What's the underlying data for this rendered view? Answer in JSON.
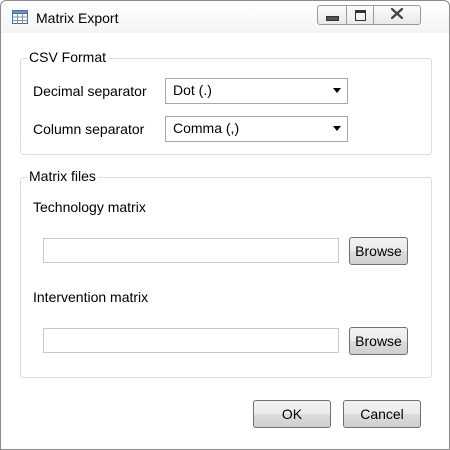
{
  "window": {
    "title": "Matrix Export",
    "icon": "table-window-icon",
    "controls": [
      "minimize-icon",
      "maximize-icon",
      "close-icon"
    ]
  },
  "csv_format": {
    "legend": "CSV Format",
    "decimal_separator": {
      "label": "Decimal separator",
      "value": "Dot (.)"
    },
    "column_separator": {
      "label": "Column separator",
      "value": "Comma (,)"
    }
  },
  "matrix_files": {
    "legend": "Matrix files",
    "technology": {
      "label": "Technology matrix",
      "value": "",
      "browse_label": "Browse"
    },
    "intervention": {
      "label": "Intervention matrix",
      "value": "",
      "browse_label": "Browse"
    }
  },
  "footer": {
    "ok_label": "OK",
    "cancel_label": "Cancel"
  }
}
